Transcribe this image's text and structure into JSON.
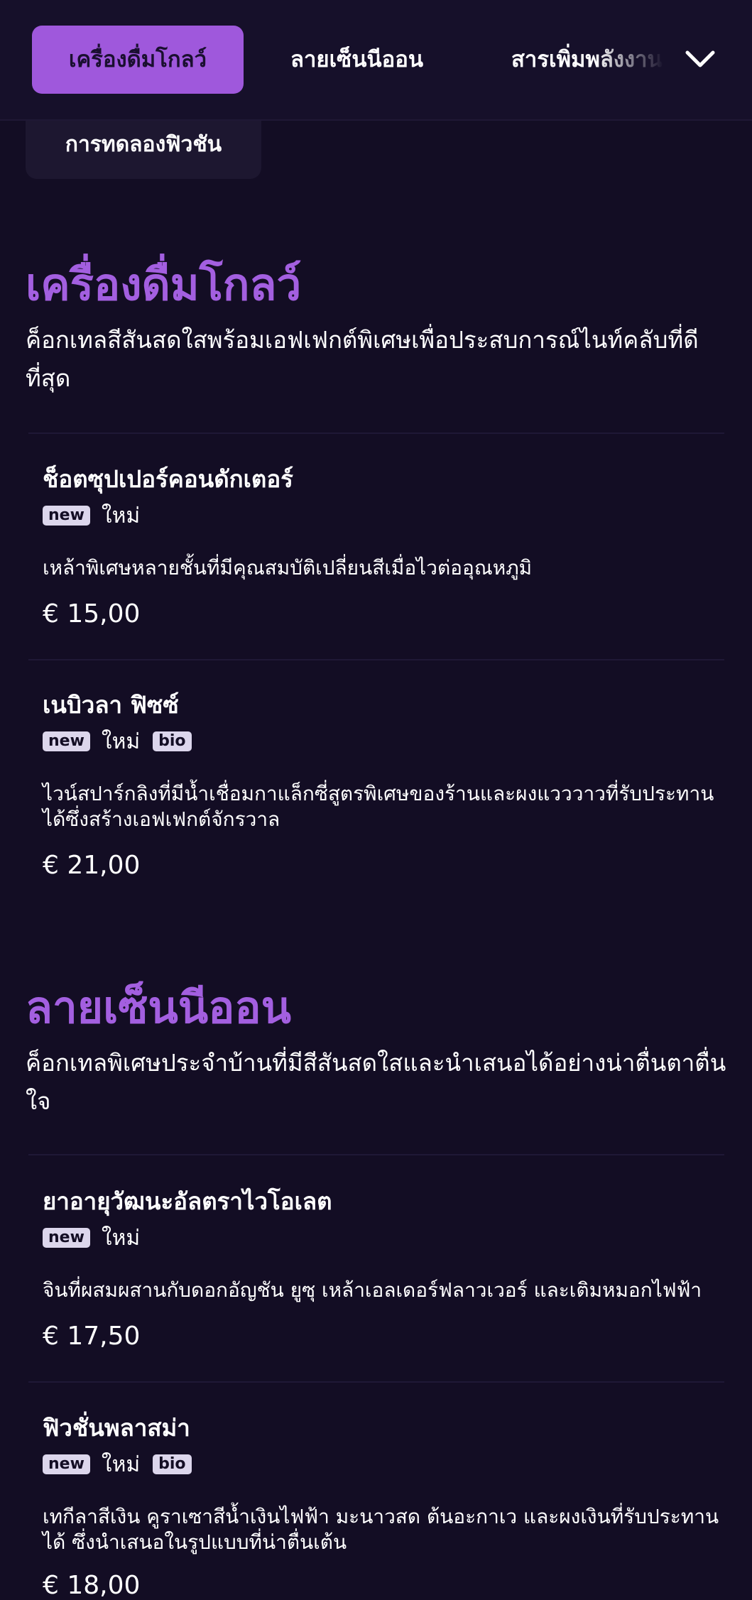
{
  "nav": {
    "tabs": [
      {
        "label": "เครื่องดื่มโกลว์",
        "active": true
      },
      {
        "label": "ลายเซ็นนีออน",
        "active": false
      },
      {
        "label": "สารเพิ่มพลังงาน",
        "active": false
      }
    ],
    "overflow_chip": "การทดลองฟิวชัน",
    "expand_icon": "chevron-down-icon"
  },
  "sections": [
    {
      "title": "เครื่องดื่มโกลว์",
      "description": "ค็อกเทลสีสันสดใสพร้อมเอฟเฟกต์พิเศษเพื่อประสบการณ์ไนท์คลับที่ดีที่สุด",
      "items": [
        {
          "name": "ช็อตซุปเปอร์คอนดักเตอร์",
          "badge_new": "new",
          "badge_new_text": "ใหม่",
          "description": "เหล้าพิเศษหลายชั้นที่มีคุณสมบัติเปลี่ยนสีเมื่อไวต่ออุณหภูมิ",
          "price": "€ 15,00"
        },
        {
          "name": "เนบิวลา ฟิซซ์",
          "badge_new": "new",
          "badge_new_text": "ใหม่",
          "badge_bio": "bio",
          "description": "ไวน์สปาร์กลิงที่มีน้ำเชื่อมกาแล็กซี่สูตรพิเศษของร้านและผงแวววาวที่รับประทานได้ซึ่งสร้างเอฟเฟกต์จักรวาล",
          "price": "€ 21,00"
        }
      ]
    },
    {
      "title": "ลายเซ็นนีออน",
      "description": "ค็อกเทลพิเศษประจำบ้านที่มีสีสันสดใสและนำเสนอได้อย่างน่าตื่นตาตื่นใจ",
      "items": [
        {
          "name": "ยาอายุวัฒนะอัลตราไวโอเลต",
          "badge_new": "new",
          "badge_new_text": "ใหม่",
          "description": "จินที่ผสมผสานกับดอกอัญชัน ยูซุ เหล้าเอลเดอร์ฟลาวเวอร์ และเติมหมอกไฟฟ้า",
          "price": "€ 17,50"
        },
        {
          "name": "ฟิวชั่นพลาสม่า",
          "badge_new": "new",
          "badge_new_text": "ใหม่",
          "badge_bio": "bio",
          "description": "เทกีลาสีเงิน คูราเซาสีน้ำเงินไฟฟ้า มะนาวสด ต้นอะกาเว และผงเงินที่รับประทานได้ ซึ่งนำเสนอในรูปแบบที่น่าตื่นเต้น",
          "price": "€ 18,00"
        }
      ]
    }
  ]
}
